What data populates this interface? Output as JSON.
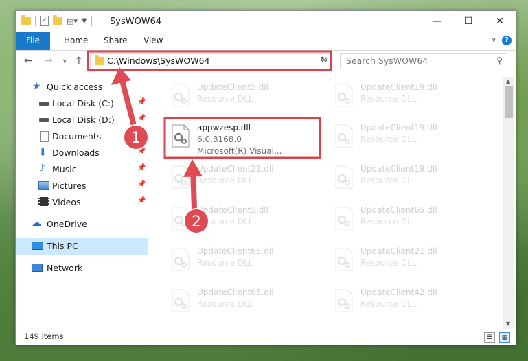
{
  "window": {
    "title": "SysWOW64"
  },
  "window_controls": {
    "minimize": "—",
    "maximize": "☐",
    "close": "✕"
  },
  "ribbon": {
    "tabs": [
      "File",
      "Home",
      "Share",
      "View"
    ],
    "help": "?"
  },
  "address": {
    "path": "C:\\Windows\\SysWOW64"
  },
  "search": {
    "placeholder": "Search SysWOW64"
  },
  "sidebar": {
    "items": [
      {
        "label": "Quick access"
      },
      {
        "label": "Local Disk (C:)"
      },
      {
        "label": "Local Disk (D:)"
      },
      {
        "label": "Documents"
      },
      {
        "label": "Downloads"
      },
      {
        "label": "Music"
      },
      {
        "label": "Pictures"
      },
      {
        "label": "Videos"
      },
      {
        "label": "OneDrive"
      },
      {
        "label": "This PC"
      },
      {
        "label": "Network"
      }
    ]
  },
  "files": [
    {
      "name": "UpdateClient5.dll",
      "desc": "Resource DLL"
    },
    {
      "name": "UpdateClient19.dll",
      "desc": "Resource DLL"
    },
    {
      "name": "appwzesp.dll",
      "desc": "6.0.8168.0",
      "desc2": "Microsoft(R) Visual..."
    },
    {
      "name": "UpdateClient19.dll",
      "desc": "Resource DLL"
    },
    {
      "name": "UpdateClient21.dll",
      "desc": "Resource DLL"
    },
    {
      "name": "UpdateClient19.dll",
      "desc": "Resource DLL"
    },
    {
      "name": "UpdateClient5.dll",
      "desc": "Resource DLL"
    },
    {
      "name": "UpdateClient65.dll",
      "desc": "Resource DLL"
    },
    {
      "name": "UpdateClient65.dll",
      "desc": "Resource DLL"
    },
    {
      "name": "UpdateClient21.dll",
      "desc": "Resource DLL"
    },
    {
      "name": "UpdateClient65.dll",
      "desc": "Resource DLL"
    },
    {
      "name": "UpdateClient42.dll",
      "desc": "Resource DLL"
    }
  ],
  "status": {
    "item_count": "149 items"
  },
  "annotations": {
    "badge1": "1",
    "badge2": "2",
    "highlight_color": "#d9434b",
    "arrow_color": "#e04a54"
  }
}
